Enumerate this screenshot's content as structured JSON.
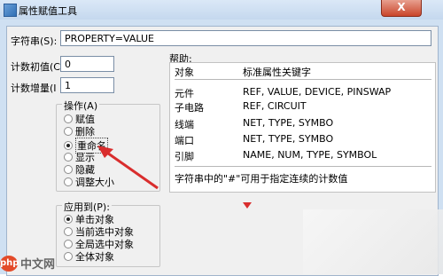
{
  "window": {
    "title": "属性赋值工具",
    "close_label": "X"
  },
  "string_field": {
    "label": "字符串(S):",
    "value": "PROPERTY=VALUE"
  },
  "count_initial": {
    "label": "计数初值(C",
    "value": "0"
  },
  "count_increment": {
    "label": "计数增量(I",
    "value": "1"
  },
  "operation_group": {
    "label": "操作(A)",
    "options": [
      {
        "label": "赋值",
        "selected": false
      },
      {
        "label": "删除",
        "selected": false
      },
      {
        "label": "重命名",
        "selected": true
      },
      {
        "label": "显示",
        "selected": false
      },
      {
        "label": "隐藏",
        "selected": false
      },
      {
        "label": "调整大小",
        "selected": false
      }
    ]
  },
  "apply_group": {
    "label": "应用到(P):",
    "options": [
      {
        "label": "单击对象",
        "selected": true
      },
      {
        "label": "当前选中对象",
        "selected": false
      },
      {
        "label": "全局选中对象",
        "selected": false
      },
      {
        "label": "全体对象",
        "selected": false
      }
    ]
  },
  "help": {
    "label": "帮助:",
    "header": {
      "col1": "对象",
      "col2": "标准属性关键字"
    },
    "rows": [
      {
        "obj": "元件",
        "keys": "REF, VALUE, DEVICE, PINSWAP"
      },
      {
        "obj": "子电路",
        "keys": "REF, CIRCUIT"
      },
      {
        "obj": "线端",
        "keys": "NET, TYPE, SYMBO"
      },
      {
        "obj": "端口",
        "keys": "NET, TYPE, SYMBO"
      },
      {
        "obj": "引脚",
        "keys": "NAME, NUM, TYPE, SYMBOL"
      }
    ],
    "note": "字符串中的\"#\"可用于指定连续的计数值"
  },
  "watermark": {
    "logo": "php",
    "text": "中文网"
  },
  "colors": {
    "annotation_arrow": "#d92d2d",
    "title_bg": "#c5d8ee"
  }
}
